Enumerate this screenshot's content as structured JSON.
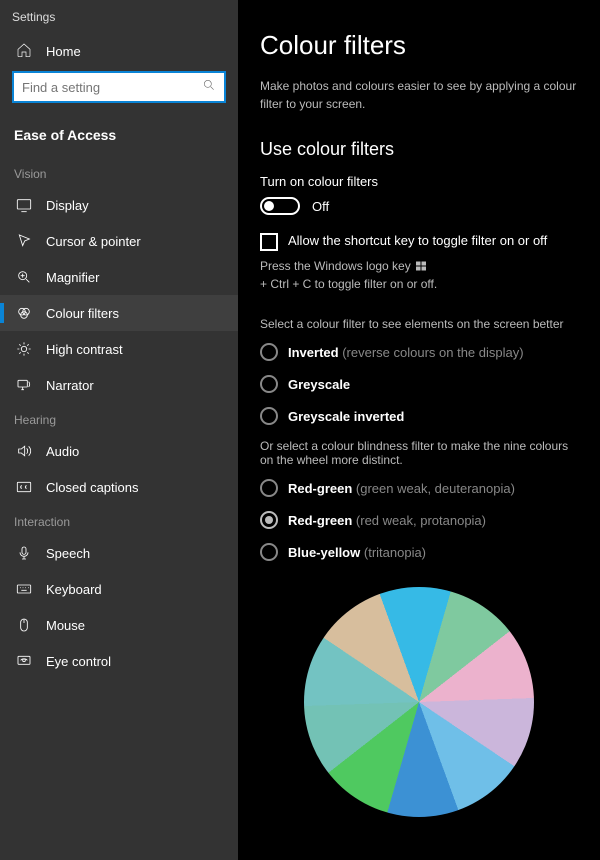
{
  "app_title": "Settings",
  "home_label": "Home",
  "search_placeholder": "Find a setting",
  "section_title": "Ease of Access",
  "groups": {
    "vision": "Vision",
    "hearing": "Hearing",
    "interaction": "Interaction"
  },
  "nav": {
    "display": "Display",
    "cursor": "Cursor & pointer",
    "magnifier": "Magnifier",
    "colour_filters": "Colour filters",
    "high_contrast": "High contrast",
    "narrator": "Narrator",
    "audio": "Audio",
    "closed_captions": "Closed captions",
    "speech": "Speech",
    "keyboard": "Keyboard",
    "mouse": "Mouse",
    "eye_control": "Eye control"
  },
  "page": {
    "title": "Colour filters",
    "description": "Make photos and colours easier to see by applying a colour filter to your screen.",
    "section_heading": "Use colour filters",
    "toggle_label": "Turn on colour filters",
    "toggle_state": "Off",
    "checkbox_label": "Allow the shortcut key to toggle filter on or off",
    "hint_pre": "Press the Windows logo key",
    "hint_post": "+ Ctrl + C to toggle filter on or off.",
    "select_instruction": "Select a colour filter to see elements on the screen better",
    "options": {
      "inverted": "Inverted",
      "inverted_hint": "(reverse colours on the display)",
      "greyscale": "Greyscale",
      "greyscale_inverted": "Greyscale inverted"
    },
    "blind_instruction": "Or select a colour blindness filter to make the nine colours on the wheel more distinct.",
    "blind_options": {
      "rg_deuter": "Red-green",
      "rg_deuter_hint": "(green weak, deuteranopia)",
      "rg_prot": "Red-green",
      "rg_prot_hint": "(red weak, protanopia)",
      "by_trit": "Blue-yellow",
      "by_trit_hint": "(tritanopia)"
    },
    "selected_option": "rg_prot"
  },
  "wheel_colors": [
    "#36bae6",
    "#7fc99f",
    "#ecb2cd",
    "#cbb6db",
    "#6fbfe8",
    "#3c91d4",
    "#4fc960",
    "#73c2b5",
    "#73c3c2",
    "#d7be9d"
  ]
}
